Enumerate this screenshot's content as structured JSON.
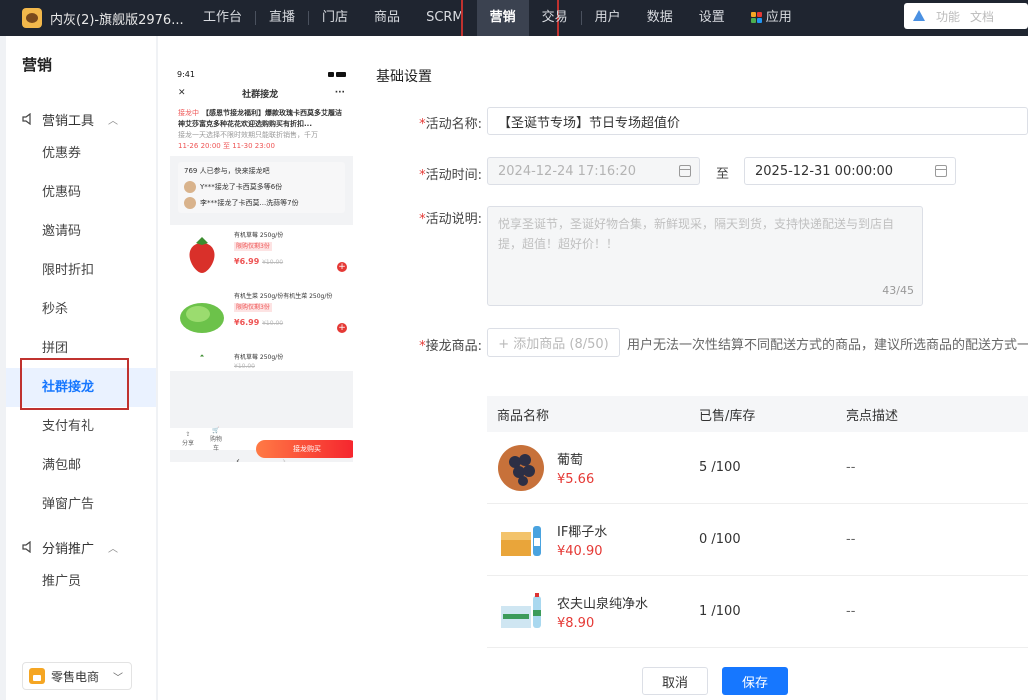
{
  "topbar": {
    "brand": "内灰(2)-旗舰版2976...",
    "nav": [
      "工作台",
      "直播",
      "门店",
      "商品",
      "SCRM",
      "营销",
      "交易",
      "用户",
      "数据",
      "设置",
      "应用"
    ],
    "active": "营销",
    "search_items": [
      "功能",
      "文档"
    ]
  },
  "sidebar": {
    "title": "营销",
    "group1": "营销工具",
    "items": [
      "优惠券",
      "优惠码",
      "邀请码",
      "限时折扣",
      "秒杀",
      "拼团",
      "社群接龙",
      "支付有礼",
      "满包邮",
      "弹窗广告"
    ],
    "active": "社群接龙",
    "group2": "分销推广",
    "items2": [
      "推广员"
    ],
    "footer": "零售电商"
  },
  "phone": {
    "time": "9:41",
    "title": "社群接龙",
    "tag": "接龙中",
    "headline": "【感恩节接龙福利】爆款玫瑰卡西莫多艾履洁神艾莎富克多种花花欢迎选购购买有折扣...",
    "desc": "接龙一天选择不限时效期只能联折销售，千万",
    "time_range": "11-26 20:00 至 11-30 23:00",
    "joined": "769 人已参与，快来接龙吧",
    "joins": [
      "Y***接龙了卡西莫多等6份",
      "李***接龙了卡西莫...洗蒜等7份"
    ],
    "goods": [
      {
        "name": "有机草莓 250g/份",
        "tag": "限购仅剩3份",
        "price": "¥6.99",
        "orig": "¥10.00"
      },
      {
        "name": "有机生菜 250g/份有机生菜 250g/份",
        "tag": "限购仅剩3份",
        "price": "¥6.99",
        "orig": "¥10.00"
      },
      {
        "name": "有机草莓 250g/份",
        "tag": "",
        "price": "",
        "orig": "¥10.00"
      }
    ],
    "share": "分享",
    "cart": "购物车",
    "buy": "接龙购买"
  },
  "form": {
    "section_title": "基础设置",
    "name_label": "活动名称:",
    "name_value": "【圣诞节专场】节日专场超值价",
    "time_label": "活动时间:",
    "start_time": "2024-12-24 17:16:20",
    "to": "至",
    "end_time": "2025-12-31 00:00:00",
    "desc_label": "活动说明:",
    "desc_value": "悦享圣诞节，圣诞好物合集，新鲜现采，隔天到货，支持快递配送与到店自提，超值！超好价！！",
    "desc_count": "43/45",
    "goods_label": "接龙商品:",
    "add_goods": "+ 添加商品 (8/50)",
    "hint": "用户无法一次性结算不同配送方式的商品，建议所选商品的配送方式一致"
  },
  "table": {
    "headers": [
      "商品名称",
      "已售/库存",
      "亮点描述"
    ],
    "rows": [
      {
        "name": "葡萄",
        "price": "¥5.66",
        "stock": "5 /100",
        "desc": "--"
      },
      {
        "name": "IF椰子水",
        "price": "¥40.90",
        "stock": "0 /100",
        "desc": "--"
      },
      {
        "name": "农夫山泉纯净水",
        "price": "¥8.90",
        "stock": "1 /100",
        "desc": "--"
      }
    ]
  },
  "buttons": {
    "cancel": "取消",
    "save": "保存"
  },
  "colors": {
    "primary": "#1677ff",
    "price": "#e53935",
    "highlight_box": "#c0322f",
    "topbar": "#1f2530"
  }
}
